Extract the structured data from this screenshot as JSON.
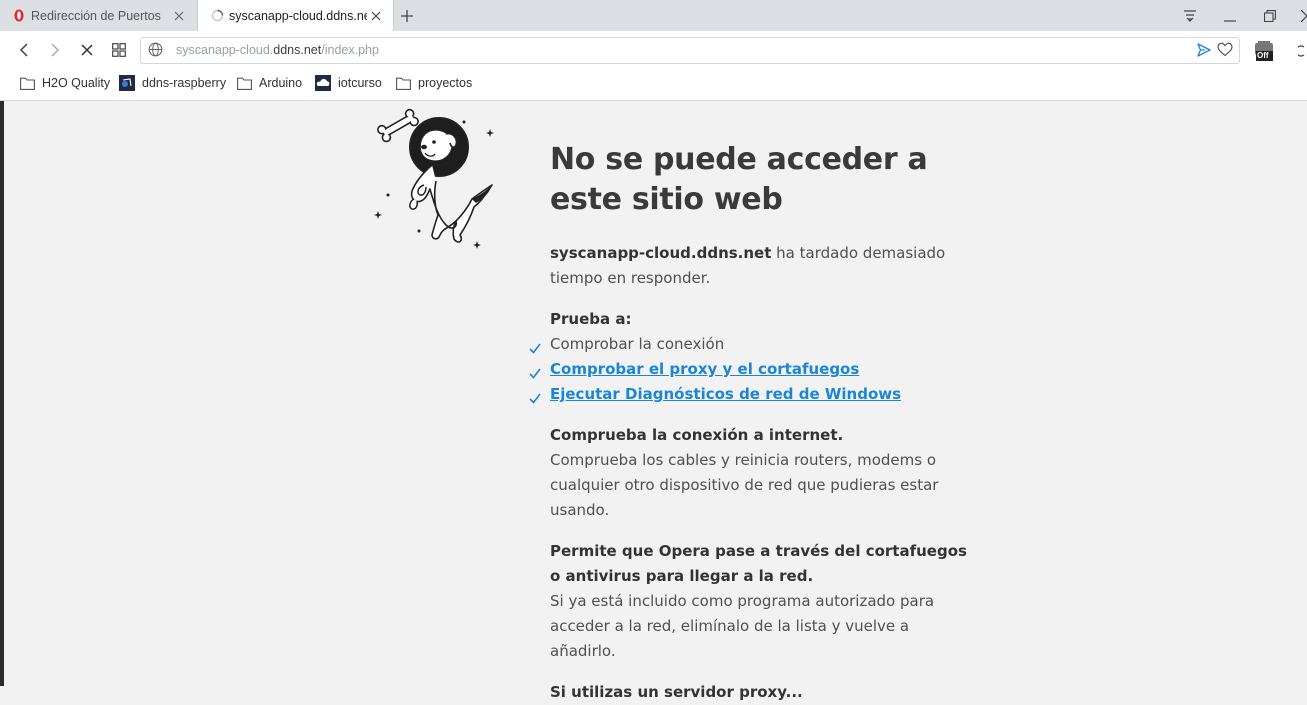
{
  "tabs": [
    {
      "title": "Redirección de Puertos",
      "active": false
    },
    {
      "title": "syscanapp-cloud.ddns.net",
      "active": true
    }
  ],
  "address": {
    "url_dim_prefix": "syscanapp-cloud.",
    "url_domain": "ddns.net",
    "url_path": "/index.php",
    "extension_badge": "Off"
  },
  "bookmarks": [
    {
      "label": "H2O Quality",
      "icon": "folder-icon"
    },
    {
      "label": "ddns-raspberry",
      "icon": "raspberry-site-icon"
    },
    {
      "label": "Arduino",
      "icon": "folder-icon"
    },
    {
      "label": "iotcurso",
      "icon": "cloud-site-icon"
    },
    {
      "label": "proyectos",
      "icon": "folder-icon"
    }
  ],
  "error": {
    "title": "No se puede acceder a este sitio web",
    "host": "syscanapp-cloud.ddns.net",
    "host_msg": " ha tardado demasiado tiempo en responder.",
    "try_heading": "Prueba a:",
    "suggestions": [
      {
        "text": "Comprobar la conexión",
        "link": false
      },
      {
        "text": "Comprobar el proxy y el cortafuegos",
        "link": true
      },
      {
        "text": "Ejecutar Diagnósticos de red de Windows",
        "link": true
      }
    ],
    "section1_title": "Comprueba la conexión a internet.",
    "section1_body": "Comprueba los cables y reinicia routers, modems o cualquier otro dispositivo de red que pudieras estar usando.",
    "section2_title": "Permite que Opera pase a través del cortafuegos o antivirus para llegar a la red.",
    "section2_body": "Si ya está incluido como programa autorizado para acceder a la red, elimínalo de la lista y vuelve a añadirlo.",
    "section3_title": "Si utilizas un servidor proxy..."
  },
  "colors": {
    "link": "#1b86d6",
    "tabstrip": "#dcdfe3",
    "page_bg": "#f2f2f2",
    "opera_red": "#e3242b"
  }
}
